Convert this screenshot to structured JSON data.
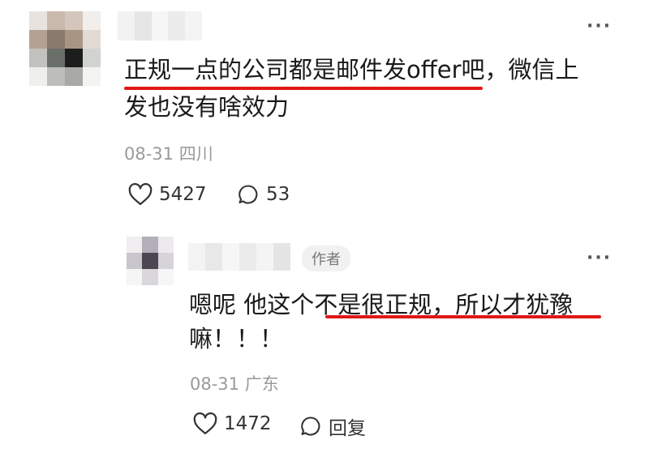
{
  "comment": {
    "text_line1": "正规一点的公司都是邮件发offer吧，微信上",
    "text_line2": "发也没有啥效力",
    "date": "08-31",
    "location": "四川",
    "likes": "5427",
    "replies": "53",
    "more_label": "···"
  },
  "reply": {
    "author_badge": "作者",
    "text_line1": "嗯呢 他这个不是很正规，所以才犹豫",
    "text_line2": "嘛！！！",
    "date": "08-31",
    "location": "广东",
    "likes": "1472",
    "reply_label": "回复",
    "more_label": "···"
  },
  "colors": {
    "highlight": "#e01818",
    "meta_text": "#9a9a9a",
    "badge_bg": "#f1f1f1"
  },
  "icons": [
    "heart-outline-icon",
    "chat-bubble-icon",
    "more-dots-icon"
  ]
}
